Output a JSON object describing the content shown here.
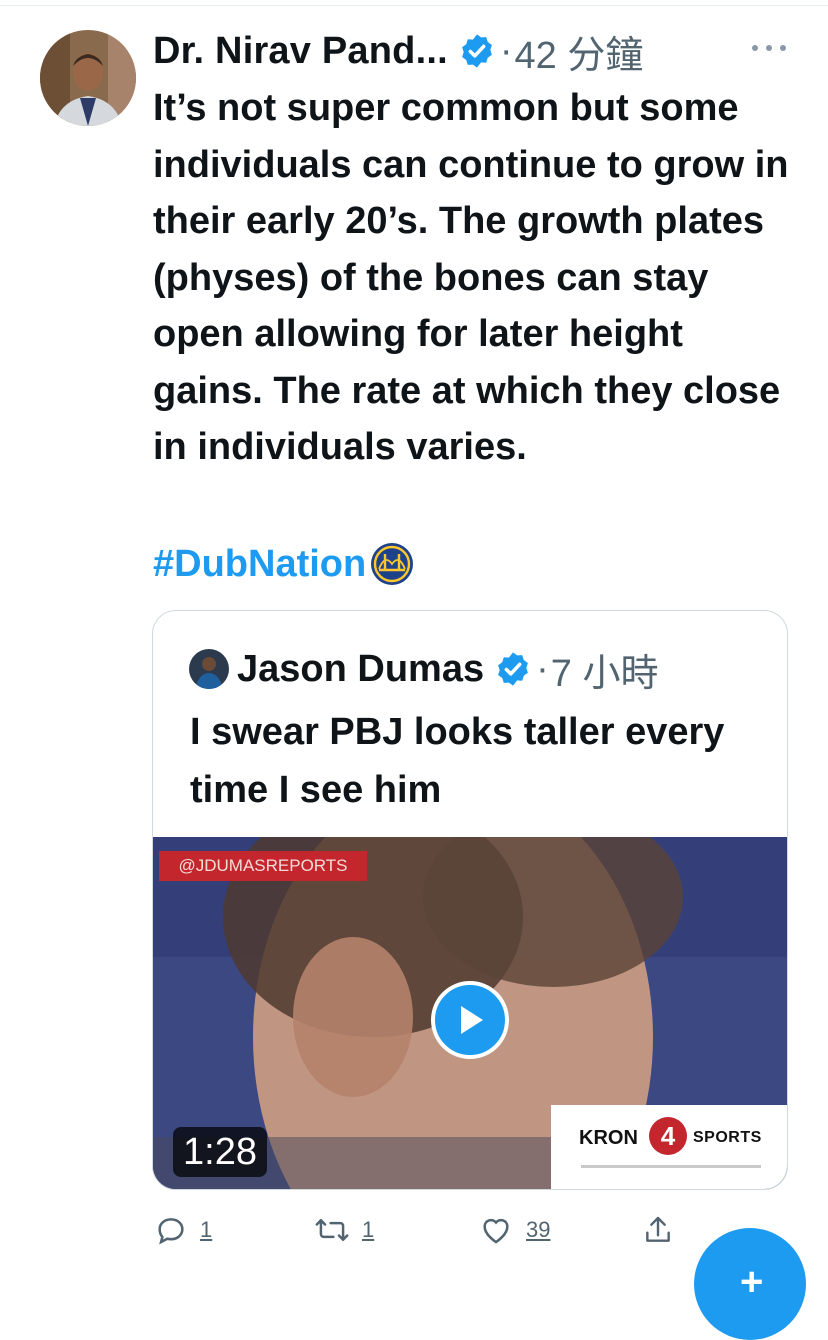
{
  "tweet": {
    "author_name": "Dr. Nirav Pand...",
    "dot": "·",
    "time": "42 分鐘",
    "body": "It’s not super common but some individuals can continue to grow in their early 20’s. The growth plates (physes) of the bones can stay open allowing for later height gains. The rate at which they close in individuals varies.",
    "hashtag": "#DubNation"
  },
  "quote": {
    "author_name": "Jason Dumas",
    "dot": "·",
    "time": "7 小時",
    "body": "I swear PBJ looks taller every time I see him",
    "media": {
      "credit": "@JDUMASREPORTS",
      "duration": "1:28",
      "logo_kron": "KRON",
      "logo_four": "4",
      "logo_sports": "SPORTS"
    }
  },
  "actions": {
    "reply_count": "1",
    "retweet_count": "1",
    "like_count": "39"
  },
  "colors": {
    "accent": "#1d9bf0",
    "secondary_text": "#536471",
    "primary_text": "#0f1419"
  },
  "icons": [
    "avatar",
    "verified-badge-icon",
    "more-icon",
    "warriors-logo-icon",
    "play-icon",
    "reply-icon",
    "retweet-icon",
    "like-icon",
    "share-icon",
    "compose-icon"
  ]
}
